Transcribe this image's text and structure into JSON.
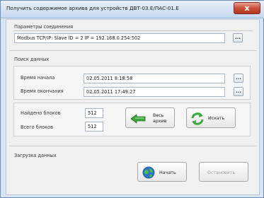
{
  "window": {
    "title": "Получить содержимое архива для устройств ДВТ-03.Е/ПАС-01.Е",
    "close_symbol": "x"
  },
  "connection": {
    "group_label": "Параметры соединения",
    "value": "Modbus TCP/IP:  Slave ID = 2  IP = 192.168.0.254:502",
    "browse_label": "..."
  },
  "search": {
    "group_label": "Поиск данных",
    "start_label": "Время начала",
    "start_value": "02.05.2011 8:18:58",
    "end_label": "Время окончания",
    "end_value": "02.05.2011 17:49:27",
    "browse_label": "...",
    "found_label": "Найдено блоков",
    "found_value": "512",
    "total_label": "Всего блоков",
    "total_value": "512",
    "whole_archive_label_line1": "Весь",
    "whole_archive_label_line2": "архив",
    "search_button_label": "Искать"
  },
  "download": {
    "group_label": "Загрузка данных",
    "start_button_label": "Начать",
    "stop_button_label": "Остановить"
  },
  "icons": {
    "close": "close-icon",
    "whole_archive": "green-arrows-icon",
    "search": "refresh-arrows-icon",
    "start": "globe-icon"
  },
  "colors": {
    "accent_green": "#3aa83c",
    "close_red": "#c9503a",
    "globe_blue": "#2b76c6"
  }
}
